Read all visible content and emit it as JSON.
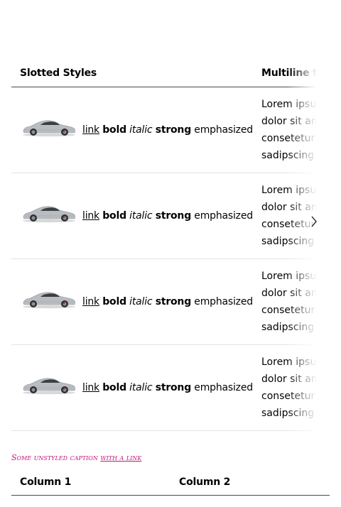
{
  "table1": {
    "headers": [
      "Slotted Styles",
      "Multiline text"
    ],
    "rows": [
      {
        "image_alt": "Porsche 911 side view",
        "rich": {
          "link": "link",
          "bold": "bold",
          "italic": "italic",
          "strong": "strong",
          "em": "emphasized"
        },
        "multiline": [
          "Lorem ipsum",
          "dolor sit amet,",
          "consetetur",
          "sadipscing"
        ]
      },
      {
        "image_alt": "Porsche 911 side view",
        "rich": {
          "link": "link",
          "bold": "bold",
          "italic": "italic",
          "strong": "strong",
          "em": "emphasized"
        },
        "multiline": [
          "Lorem ipsum",
          "dolor sit amet,",
          "consetetur",
          "sadipscing"
        ]
      },
      {
        "image_alt": "Porsche 911 side view",
        "rich": {
          "link": "link",
          "bold": "bold",
          "italic": "italic",
          "strong": "strong",
          "em": "emphasized"
        },
        "multiline": [
          "Lorem ipsum",
          "dolor sit amet,",
          "consetetur",
          "sadipscing"
        ]
      },
      {
        "image_alt": "Porsche 911 side view",
        "rich": {
          "link": "link",
          "bold": "bold",
          "italic": "italic",
          "strong": "strong",
          "em": "emphasized"
        },
        "multiline": [
          "Lorem ipsum",
          "dolor sit amet,",
          "consetetur",
          "sadipscing"
        ]
      }
    ],
    "scroll_icon": "chevron-right-icon"
  },
  "caption": {
    "text": "Some unstyled caption ",
    "link": "with a link"
  },
  "table2": {
    "headers": [
      "Column 1",
      "Column 2"
    ]
  },
  "colors": {
    "text": "#010205",
    "caption": "#c0167a",
    "divider": "#e3e4e5",
    "header_border": "#4a4a4a"
  }
}
